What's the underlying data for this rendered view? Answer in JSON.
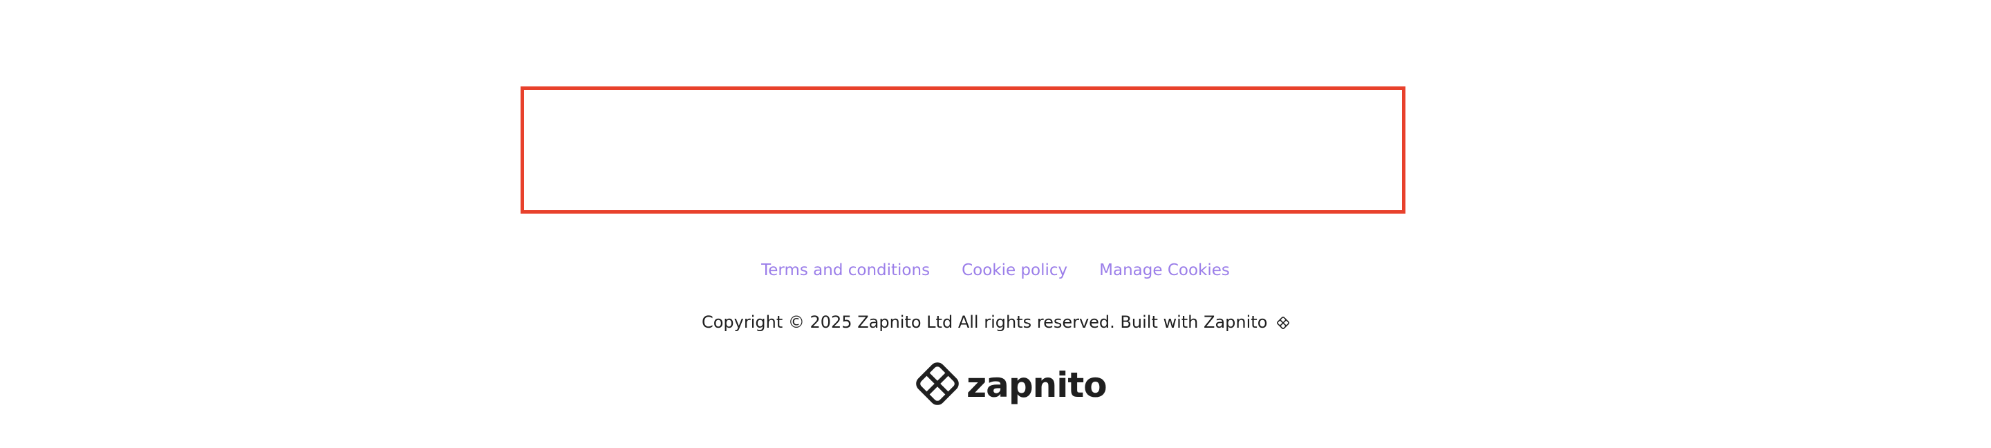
{
  "embed": {
    "border_color": "#e8412c"
  },
  "footer": {
    "links": [
      {
        "label": "Terms and conditions"
      },
      {
        "label": "Cookie policy"
      },
      {
        "label": "Manage Cookies"
      }
    ],
    "link_color": "#9b7ee9",
    "copyright": "Copyright © 2025 Zapnito Ltd All rights reserved. Built with Zapnito",
    "copyright_icon": "zapnito-mark-icon",
    "brand": {
      "logo_icon": "zapnito-logo-icon",
      "name": "zapnito"
    }
  }
}
